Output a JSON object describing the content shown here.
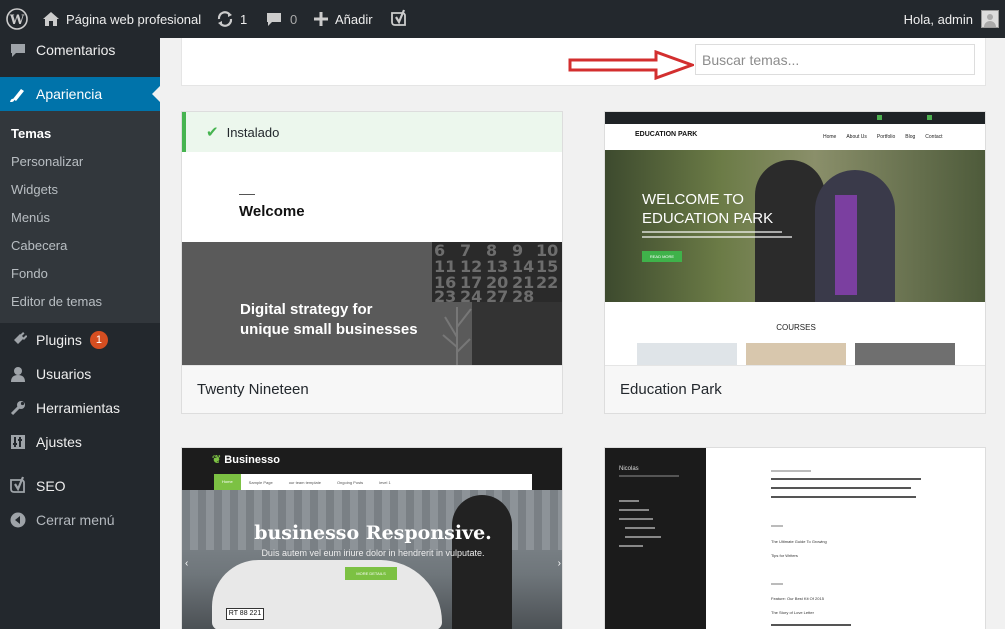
{
  "adminbar": {
    "site_name": "Página web profesional",
    "updates_count": "1",
    "comments_count": "0",
    "new_label": "Añadir",
    "greeting": "Hola, admin"
  },
  "sidebar": {
    "comments": "Comentarios",
    "appearance": "Apariencia",
    "submenu": [
      "Temas",
      "Personalizar",
      "Widgets",
      "Menús",
      "Cabecera",
      "Fondo",
      "Editor de temas"
    ],
    "plugins": "Plugins",
    "plugins_badge": "1",
    "users": "Usuarios",
    "tools": "Herramientas",
    "settings": "Ajustes",
    "seo": "SEO",
    "collapse": "Cerrar menú"
  },
  "search": {
    "placeholder": "Buscar temas..."
  },
  "themes": {
    "twenty_nineteen": {
      "notice": "Instalado",
      "shot_welcome": "Welcome",
      "shot_tagline_1": "Digital strategy for",
      "shot_tagline_2": "unique small businesses",
      "calendar_numbers": [
        "6",
        "7",
        "8",
        "9",
        "10",
        "11",
        "12",
        "13",
        "14",
        "15",
        "16",
        "17",
        "20",
        "21",
        "22",
        "23",
        "24",
        "27",
        "28"
      ],
      "name": "Twenty Nineteen"
    },
    "education_park": {
      "brand": "EDUCATION PARK",
      "nav": [
        "Home",
        "About Us",
        "Portfolio",
        "Blog",
        "Contact"
      ],
      "hero_1": "WELCOME TO",
      "hero_2": "EDUCATION PARK",
      "hero_button": "READ MORE",
      "courses": "COURSES",
      "name": "Education Park"
    },
    "businesso": {
      "brand": "Businesso",
      "nav": [
        "Home",
        "Sample Page",
        "our team template",
        "Ongoing Posts",
        "level 1"
      ],
      "hero_title": "businesso Responsive.",
      "hero_sub": "Duis autem vel eum iriure dolor in hendrerit in vulputate.",
      "hero_button": "MORE DETAILS",
      "plate": "RT 88 221"
    },
    "minimal": {
      "site": "Nicolas",
      "recent_1": "The Ultimate Guide To Growing",
      "recent_2": "Tips for Writers",
      "list_1": "Feature: Our Best Kit Of 2015",
      "list_2": "The Story of Love Letter"
    }
  },
  "colors": {
    "adminbar": "#23282d",
    "active_menu": "#0073aa",
    "notice_green": "#46b450",
    "badge": "#d54e21"
  }
}
